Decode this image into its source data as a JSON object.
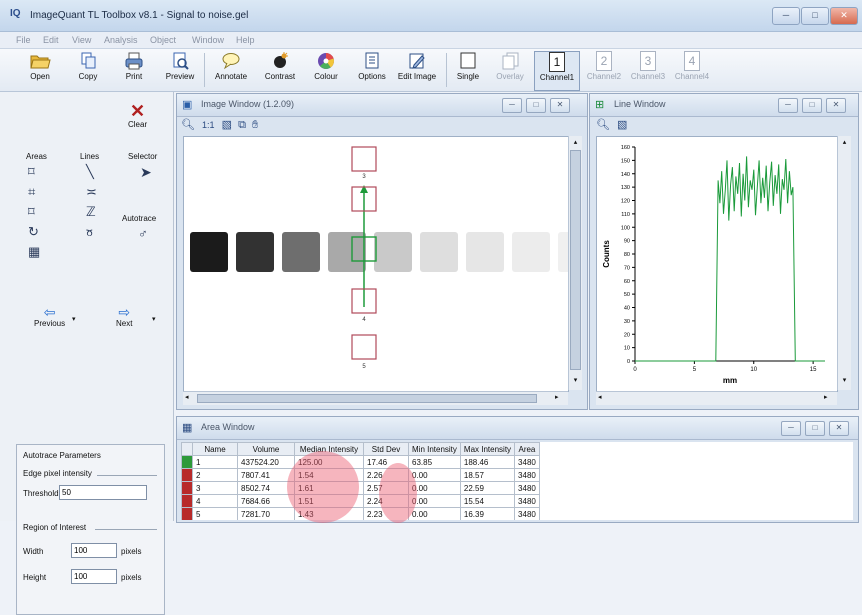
{
  "window": {
    "app_logo": "IQ",
    "title": "ImageQuant TL Toolbox v8.1 - Signal to noise.gel",
    "controls": [
      "─",
      "□",
      "✕"
    ]
  },
  "menu": [
    "File",
    "Edit",
    "View",
    "Analysis",
    "Object",
    "Window",
    "Help"
  ],
  "toolbar": {
    "buttons": [
      {
        "label": "Open",
        "icon": "folder-open-icon"
      },
      {
        "label": "Copy",
        "icon": "copy-icon"
      },
      {
        "label": "Print",
        "icon": "printer-icon"
      },
      {
        "label": "Preview",
        "icon": "preview-icon"
      },
      {
        "label": "Annotate",
        "icon": "speech-bubble-icon"
      },
      {
        "label": "Contrast",
        "icon": "contrast-icon"
      },
      {
        "label": "Colour",
        "icon": "colour-wheel-icon"
      },
      {
        "label": "Options",
        "icon": "options-icon"
      },
      {
        "label": "Edit Image",
        "icon": "edit-image-icon"
      }
    ],
    "view_buttons": [
      {
        "label": "Single",
        "glyph": "",
        "disabled": false
      },
      {
        "label": "Overlay",
        "glyph": "",
        "disabled": true
      },
      {
        "label": "Channel1",
        "glyph": "1",
        "disabled": false
      },
      {
        "label": "Channel2",
        "glyph": "2",
        "disabled": true
      },
      {
        "label": "Channel3",
        "glyph": "3",
        "disabled": true
      },
      {
        "label": "Channel4",
        "glyph": "4",
        "disabled": true
      }
    ]
  },
  "tools": {
    "clear_label": "Clear",
    "areas_label": "Areas",
    "lines_label": "Lines",
    "selector_label": "Selector",
    "autotrace_label": "Autotrace",
    "previous_label": "Previous",
    "next_label": "Next"
  },
  "autotrace": {
    "title": "Autotrace Parameters",
    "edge_label": "Edge pixel intensity",
    "threshold_label": "Threshold",
    "threshold_value": "50",
    "roi_label": "Region of Interest",
    "width_label": "Width",
    "width_value": "100",
    "width_unit": "pixels",
    "height_label": "Height",
    "height_value": "100",
    "height_unit": "pixels"
  },
  "image_window": {
    "title": "Image Window (1.2.09)",
    "band_colors": [
      "#1b1b1b",
      "#323232",
      "#6e6e6e",
      "#a9a9a9",
      "#c9c9c9",
      "#dedede",
      "#e6e6e6",
      "#ececec",
      "#f0f0f0"
    ],
    "box_labels": [
      "3",
      "4",
      "5"
    ]
  },
  "line_window": {
    "title": "Line Window",
    "chart_data": {
      "type": "line",
      "ylabel": "Counts",
      "xlabel": "mm",
      "xlim": [
        0,
        16
      ],
      "ylim": [
        0,
        160
      ],
      "yticks": [
        0,
        10,
        20,
        30,
        40,
        50,
        60,
        70,
        80,
        90,
        100,
        110,
        120,
        130,
        140,
        150,
        160
      ],
      "yticklabels": [
        "0",
        "10",
        "20",
        "30",
        "40",
        "50",
        "60",
        "70",
        "80",
        "90",
        "100",
        "110",
        "120",
        "130",
        "140",
        "150",
        "160"
      ],
      "xticks": [
        0,
        5,
        10,
        15
      ],
      "xticklabels": [
        "0",
        "5",
        "10",
        "15"
      ],
      "color": "#1a9a3a",
      "series": [
        {
          "x": [
            0,
            6.8,
            7.0,
            7.15,
            7.3,
            7.45,
            7.6,
            7.75,
            7.9,
            8.05,
            8.2,
            8.35,
            8.5,
            8.65,
            8.8,
            8.95,
            9.1,
            9.25,
            9.4,
            9.55,
            9.7,
            9.85,
            10.0,
            10.15,
            10.3,
            10.45,
            10.6,
            10.75,
            10.9,
            11.05,
            11.2,
            11.35,
            11.5,
            11.65,
            11.8,
            11.95,
            12.1,
            12.25,
            12.4,
            12.55,
            12.7,
            12.85,
            13.0,
            13.15,
            13.3,
            13.5,
            16
          ],
          "y": [
            0,
            0,
            135,
            118,
            142,
            110,
            128,
            150,
            105,
            132,
            145,
            112,
            138,
            125,
            148,
            108,
            140,
            120,
            153,
            115,
            135,
            128,
            143,
            109,
            130,
            150,
            118,
            137,
            122,
            146,
            112,
            134,
            149,
            116,
            139,
            125,
            147,
            110,
            136,
            128,
            151,
            118,
            142,
            124,
            130,
            0,
            0
          ]
        }
      ]
    }
  },
  "area_window": {
    "title": "Area Window",
    "columns": [
      "",
      "Name",
      "Volume",
      "Median Intensity",
      "Std Dev",
      "Min Intensity",
      "Max Intensity",
      "Area"
    ],
    "rows": [
      {
        "color": "#2e9a3a",
        "name": "1",
        "volume": "437524.20",
        "median": "125.00",
        "std": "17.46",
        "min": "63.85",
        "max": "188.46",
        "area": "3480"
      },
      {
        "color": "#b82a2a",
        "name": "2",
        "volume": "7807.41",
        "median": "1.54",
        "std": "2.26",
        "min": "0.00",
        "max": "18.57",
        "area": "3480"
      },
      {
        "color": "#b82a2a",
        "name": "3",
        "volume": "8502.74",
        "median": "1.61",
        "std": "2.57",
        "min": "0.00",
        "max": "22.59",
        "area": "3480"
      },
      {
        "color": "#b82a2a",
        "name": "4",
        "volume": "7684.66",
        "median": "1.51",
        "std": "2.24",
        "min": "0.00",
        "max": "15.54",
        "area": "3480"
      },
      {
        "color": "#b82a2a",
        "name": "5",
        "volume": "7281.70",
        "median": "1.43",
        "std": "2.23",
        "min": "0.00",
        "max": "16.39",
        "area": "3480"
      }
    ]
  }
}
